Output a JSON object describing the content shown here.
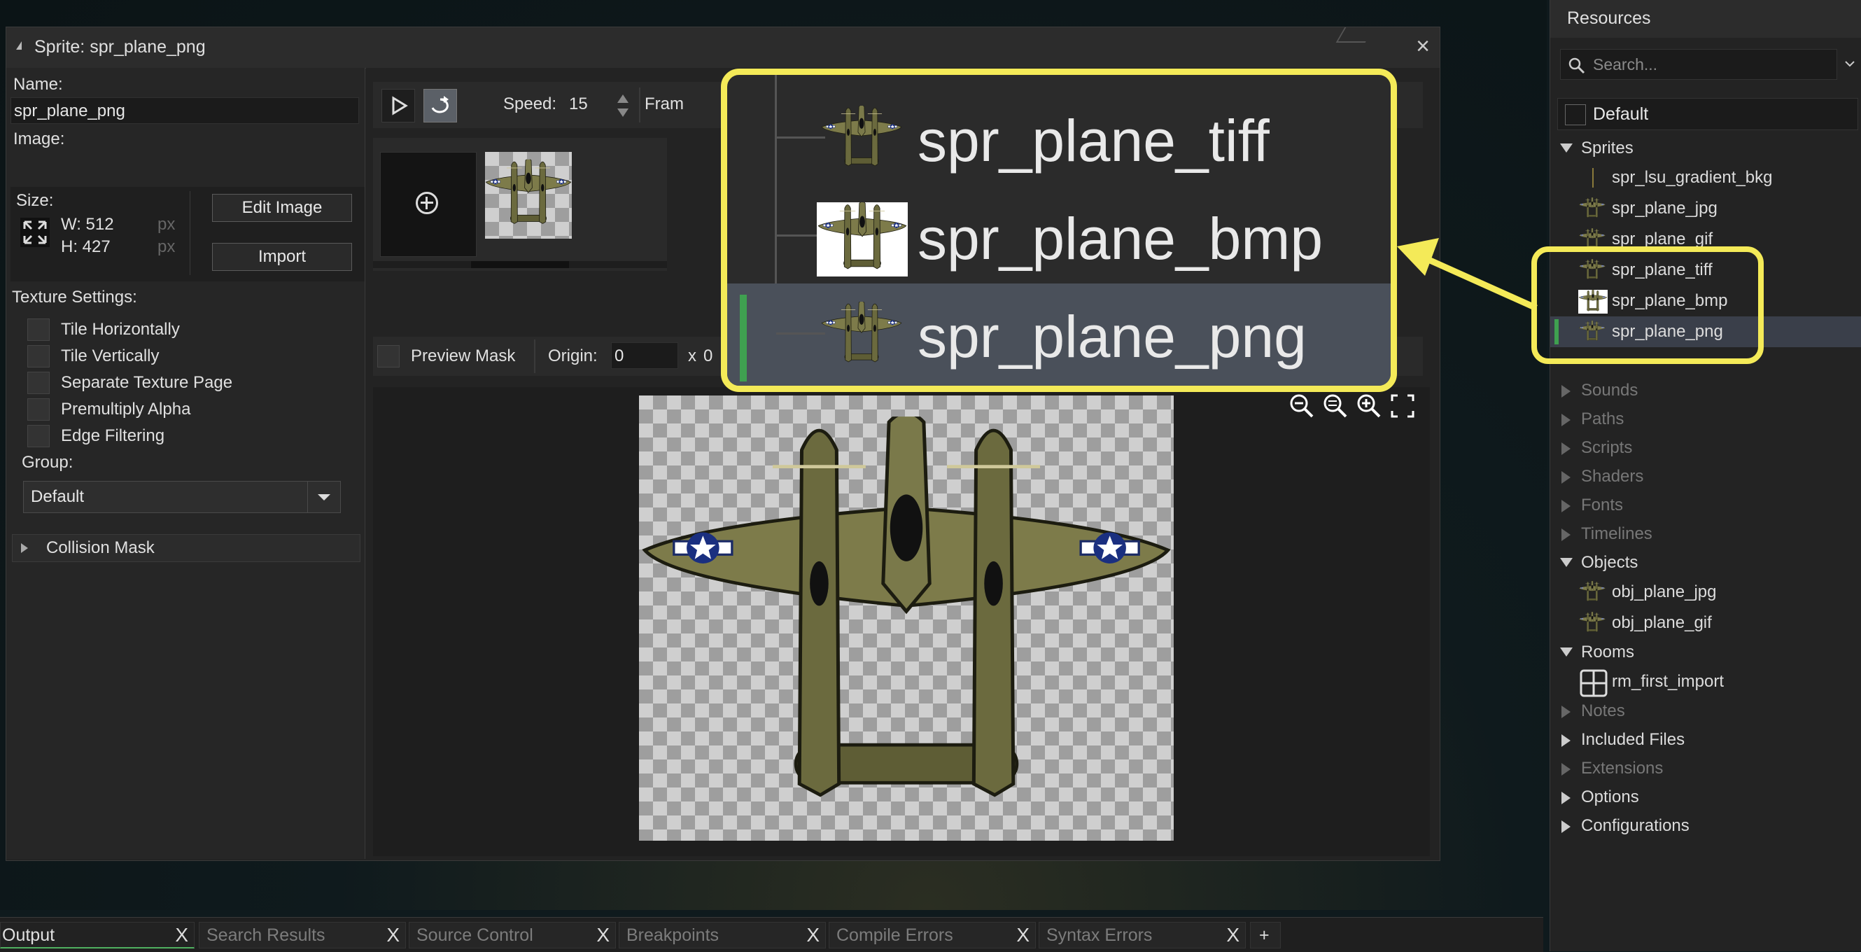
{
  "editor": {
    "window_title": "Sprite: spr_plane_png",
    "name_label": "Name:",
    "name_value": "spr_plane_png",
    "image_label": "Image:",
    "size_label": "Size:",
    "width": "W: 512",
    "height": "H: 427",
    "unit": "px",
    "edit_image": "Edit Image",
    "import": "Import",
    "texture_settings_label": "Texture Settings:",
    "texture_options": [
      "Tile Horizontally",
      "Tile Vertically",
      "Separate Texture Page",
      "Premultiply Alpha",
      "Edge Filtering"
    ],
    "group_label": "Group:",
    "group_value": "Default",
    "collision_mask": "Collision Mask",
    "speed_label": "Speed:",
    "speed_value": "15",
    "frames_label": "Fram",
    "preview_mask": "Preview Mask",
    "origin_label": "Origin:",
    "origin_x": "0",
    "origin_sep": "x",
    "origin_y": "0"
  },
  "resources": {
    "title": "Resources",
    "search_placeholder": "Search...",
    "default_group": "Default",
    "groups": {
      "sprites": "Sprites",
      "sounds": "Sounds",
      "paths": "Paths",
      "scripts": "Scripts",
      "shaders": "Shaders",
      "fonts": "Fonts",
      "timelines": "Timelines",
      "objects": "Objects",
      "rooms": "Rooms",
      "notes": "Notes",
      "included_files": "Included Files",
      "extensions": "Extensions",
      "options": "Options",
      "configurations": "Configurations"
    },
    "sprites": [
      "spr_lsu_gradient_bkg",
      "spr_plane_jpg",
      "spr_plane_gif",
      "spr_plane_tiff",
      "spr_plane_bmp",
      "spr_plane_png"
    ],
    "objects": [
      "obj_plane_jpg",
      "obj_plane_gif"
    ],
    "rooms": [
      "rm_first_import"
    ]
  },
  "callout": {
    "items": [
      "spr_plane_tiff",
      "spr_plane_bmp",
      "spr_plane_png"
    ],
    "color": "#f4ea58"
  },
  "bottom_tabs": [
    "Output",
    "Search Results",
    "Source Control",
    "Breakpoints",
    "Compile Errors",
    "Syntax Errors"
  ],
  "bottom_add": "+"
}
